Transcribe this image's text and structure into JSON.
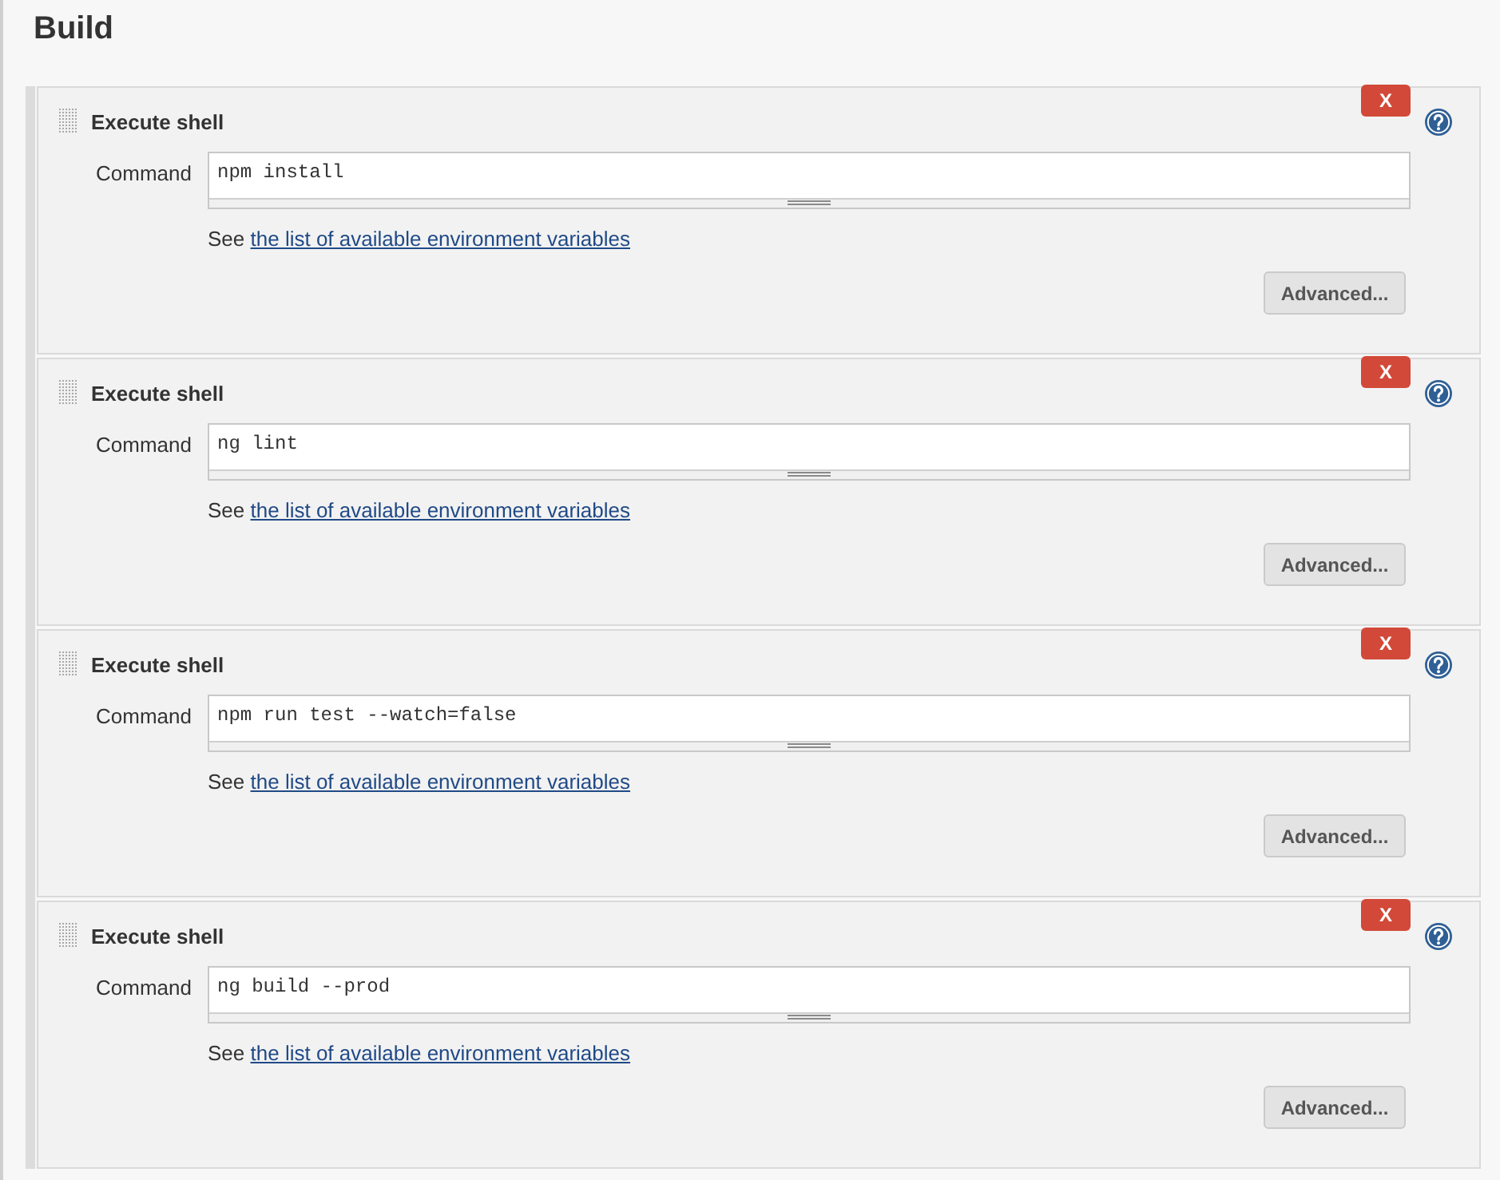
{
  "heading": "Build",
  "steps": [
    {
      "title": "Execute shell",
      "delete_label": "X",
      "field_label": "Command",
      "command": "npm install",
      "hint_prefix": "See",
      "hint_link": "the list of available environment variables",
      "advanced_label": "Advanced..."
    },
    {
      "title": "Execute shell",
      "delete_label": "X",
      "field_label": "Command",
      "command": "ng lint",
      "hint_prefix": "See",
      "hint_link": "the list of available environment variables",
      "advanced_label": "Advanced..."
    },
    {
      "title": "Execute shell",
      "delete_label": "X",
      "field_label": "Command",
      "command": "npm run test --watch=false",
      "hint_prefix": "See",
      "hint_link": "the list of available environment variables",
      "advanced_label": "Advanced..."
    },
    {
      "title": "Execute shell",
      "delete_label": "X",
      "field_label": "Command",
      "command": "ng build --prod",
      "hint_prefix": "See",
      "hint_link": "the list of available environment variables",
      "advanced_label": "Advanced..."
    }
  ]
}
